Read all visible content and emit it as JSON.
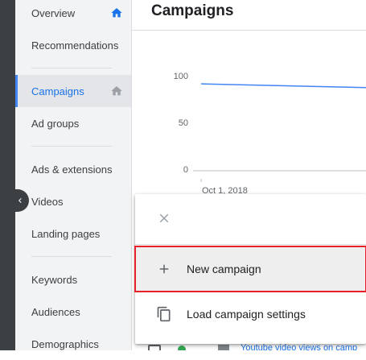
{
  "sidebar": {
    "items": [
      {
        "label": "Overview"
      },
      {
        "label": "Recommendations"
      },
      {
        "label": "Campaigns"
      },
      {
        "label": "Ad groups"
      },
      {
        "label": "Ads & extensions"
      },
      {
        "label": "Videos"
      },
      {
        "label": "Landing pages"
      },
      {
        "label": "Keywords"
      },
      {
        "label": "Audiences"
      },
      {
        "label": "Demographics"
      }
    ],
    "active_index": 2
  },
  "header": {
    "title": "Campaigns"
  },
  "chart_data": {
    "type": "line",
    "title": "",
    "xlabel": "",
    "ylabel": "",
    "yticks": [
      "100",
      "50",
      "0"
    ],
    "xticks": [
      "Oct 1, 2018"
    ],
    "ylim": [
      0,
      100
    ],
    "series": [
      {
        "values": [
          93,
          89
        ]
      }
    ],
    "grid": false,
    "color": "#4285f4"
  },
  "popup": {
    "items": [
      {
        "label": "New campaign",
        "icon": "plus-icon"
      },
      {
        "label": "Load campaign settings",
        "icon": "copy-icon"
      }
    ],
    "close_icon": "close-icon",
    "highlight_color": "#e8202a"
  },
  "table_peek": {
    "text": "Youtube video views on camp"
  },
  "colors": {
    "accent": "#1a73e8",
    "sidebar_bg": "#f1f3f4",
    "dark_strip": "#3c4043"
  }
}
